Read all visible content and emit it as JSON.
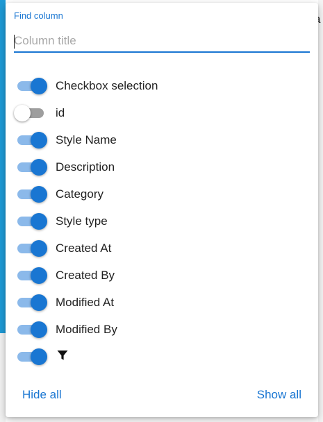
{
  "background": {
    "partial_text": "a"
  },
  "colors": {
    "accent": "#1976d2",
    "track_on": "#8bb9ea",
    "track_off": "#9e9e9e",
    "side_bar": "#1e9ad6"
  },
  "search": {
    "label": "Find column",
    "placeholder": "Column title",
    "value": ""
  },
  "columns": [
    {
      "label": "Checkbox selection",
      "enabled": true
    },
    {
      "label": "id",
      "enabled": false
    },
    {
      "label": "Style Name",
      "enabled": true
    },
    {
      "label": "Description",
      "enabled": true
    },
    {
      "label": "Category",
      "enabled": true
    },
    {
      "label": "Style type",
      "enabled": true
    },
    {
      "label": "Created At",
      "enabled": true
    },
    {
      "label": "Created By",
      "enabled": true
    },
    {
      "label": "Modified At",
      "enabled": true
    },
    {
      "label": "Modified By",
      "enabled": true
    },
    {
      "icon": "filter-icon",
      "enabled": true
    }
  ],
  "footer": {
    "hide_all": "Hide all",
    "show_all": "Show all"
  }
}
